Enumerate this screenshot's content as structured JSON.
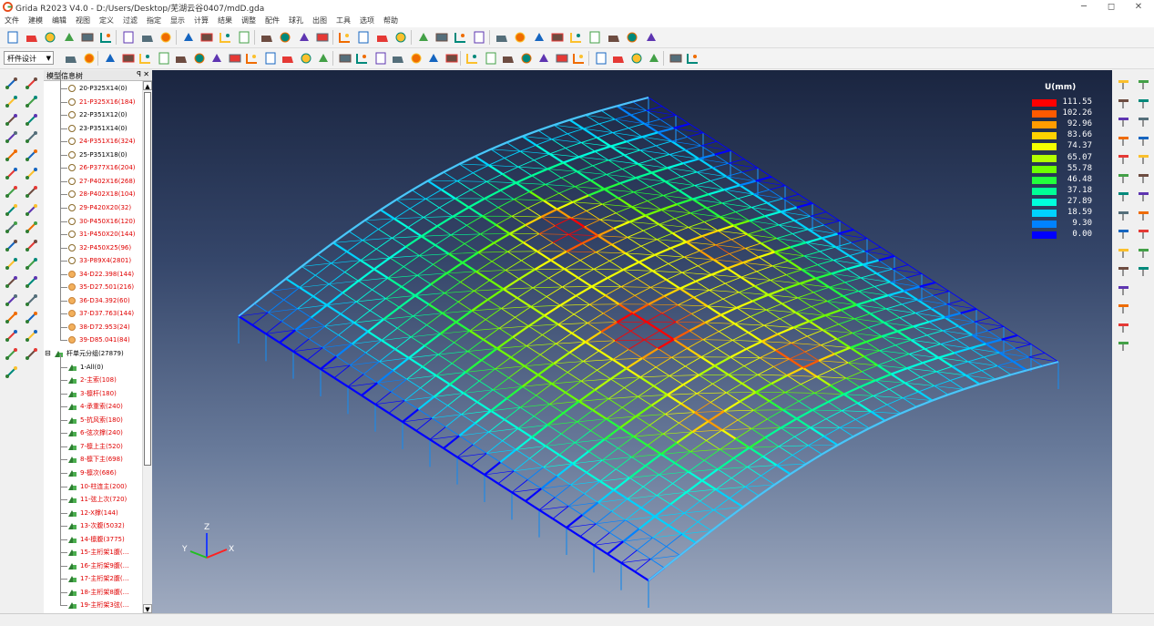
{
  "window": {
    "title": "Grida R2023 V4.0 - D:/Users/Desktop/芜湖云谷0407/mdD.gda",
    "minimize": "─",
    "maximize": "◻",
    "close": "✕"
  },
  "menu": [
    "文件",
    "建模",
    "编辑",
    "视图",
    "定义",
    "过滤",
    "指定",
    "显示",
    "计算",
    "结果",
    "调整",
    "配件",
    "球孔",
    "出图",
    "工具",
    "选项",
    "帮助"
  ],
  "toolbar": {
    "mode_combo": "杆件设计"
  },
  "tree": {
    "title": "模型信息树",
    "pin": "ꟼ",
    "close": "✕",
    "sections": [
      {
        "label": "20-P325X14(0)",
        "red": false,
        "icon": "o"
      },
      {
        "label": "21-P325X16(184)",
        "red": true,
        "icon": "o"
      },
      {
        "label": "22-P351X12(0)",
        "red": false,
        "icon": "o"
      },
      {
        "label": "23-P351X14(0)",
        "red": false,
        "icon": "o"
      },
      {
        "label": "24-P351X16(324)",
        "red": true,
        "icon": "o"
      },
      {
        "label": "25-P351X18(0)",
        "red": false,
        "icon": "o"
      },
      {
        "label": "26-P377X16(204)",
        "red": true,
        "icon": "o"
      },
      {
        "label": "27-P402X16(268)",
        "red": true,
        "icon": "o"
      },
      {
        "label": "28-P402X18(104)",
        "red": true,
        "icon": "o"
      },
      {
        "label": "29-P420X20(32)",
        "red": true,
        "icon": "o"
      },
      {
        "label": "30-P450X16(120)",
        "red": true,
        "icon": "o"
      },
      {
        "label": "31-P450X20(144)",
        "red": true,
        "icon": "o"
      },
      {
        "label": "32-P450X25(96)",
        "red": true,
        "icon": "o"
      },
      {
        "label": "33-P89X4(2801)",
        "red": true,
        "icon": "o"
      },
      {
        "label": "34-D22.398(144)",
        "red": true,
        "icon": "f"
      },
      {
        "label": "35-D27.501(216)",
        "red": true,
        "icon": "f"
      },
      {
        "label": "36-D34.392(60)",
        "red": true,
        "icon": "f"
      },
      {
        "label": "37-D37.763(144)",
        "red": true,
        "icon": "f"
      },
      {
        "label": "38-D72.953(24)",
        "red": true,
        "icon": "f"
      },
      {
        "label": "39-D85.041(84)",
        "red": true,
        "icon": "f"
      }
    ],
    "group_header": "杆单元分组(27879)",
    "group_toggle": "⊟",
    "groups": [
      {
        "label": "1-All(0)",
        "red": false
      },
      {
        "label": "2-主索(108)",
        "red": true
      },
      {
        "label": "3-檩杆(180)",
        "red": true
      },
      {
        "label": "4-承重索(240)",
        "red": true
      },
      {
        "label": "5-抗风索(180)",
        "red": true
      },
      {
        "label": "6-弦次撑(240)",
        "red": true
      },
      {
        "label": "7-檩上主(520)",
        "red": true
      },
      {
        "label": "8-檩下主(698)",
        "red": true
      },
      {
        "label": "9-檩次(686)",
        "red": true
      },
      {
        "label": "10-柱连主(200)",
        "red": true
      },
      {
        "label": "11-弦上次(720)",
        "red": true
      },
      {
        "label": "12-X撑(144)",
        "red": true
      },
      {
        "label": "13-次腹(5032)",
        "red": true
      },
      {
        "label": "14-檩腹(3775)",
        "red": true
      },
      {
        "label": "15-主桁架1腹(…",
        "red": true
      },
      {
        "label": "16-主桁架9腹(…",
        "red": true
      },
      {
        "label": "17-主桁架2腹(…",
        "red": true
      },
      {
        "label": "18-主桁架8腹(…",
        "red": true
      },
      {
        "label": "19-主桁架3弦(…",
        "red": true
      }
    ]
  },
  "legend": {
    "title": "U(mm)",
    "entries": [
      {
        "value": "111.55",
        "color": "#ff0000"
      },
      {
        "value": "102.26",
        "color": "#ff5a00"
      },
      {
        "value": "92.96",
        "color": "#ff9c00"
      },
      {
        "value": "83.66",
        "color": "#ffd200"
      },
      {
        "value": "74.37",
        "color": "#f2ff00"
      },
      {
        "value": "65.07",
        "color": "#b4ff00"
      },
      {
        "value": "55.78",
        "color": "#6eff00"
      },
      {
        "value": "46.48",
        "color": "#22ff3c"
      },
      {
        "value": "37.18",
        "color": "#00ff96"
      },
      {
        "value": "27.89",
        "color": "#00ffdc"
      },
      {
        "value": "18.59",
        "color": "#00d2ff"
      },
      {
        "value": "9.30",
        "color": "#0082ff"
      },
      {
        "value": "0.00",
        "color": "#0000ff"
      }
    ]
  },
  "triad": {
    "x": "X",
    "y": "Y",
    "z": "Z"
  }
}
